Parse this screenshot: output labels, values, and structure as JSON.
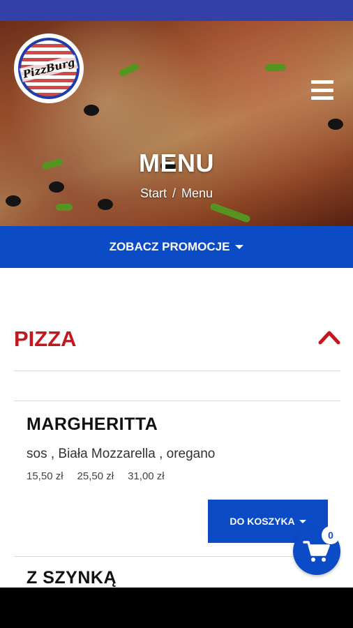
{
  "header": {
    "logo_text": "PizzBurg",
    "title": "MENU",
    "breadcrumb": {
      "start": "Start",
      "separator": "/",
      "current": "Menu"
    }
  },
  "promo": {
    "label": "ZOBACZ PROMOCJE"
  },
  "section": {
    "title": "PIZZA"
  },
  "items": [
    {
      "name": "MARGHERITTA",
      "description": "sos , Biała Mozzarella , oregano",
      "prices": [
        "15,50 zł",
        "25,50 zł",
        "31,00 zł"
      ],
      "add_label": "DO KOSZYKA"
    },
    {
      "name": "Z SZYNKĄ"
    }
  ],
  "cart": {
    "count": "0"
  },
  "colors": {
    "accent": "#0c4bc6",
    "status_bar": "#3240a8",
    "section_title": "#c4161c"
  },
  "icons": {
    "menu": "hamburger-icon",
    "collapse": "chevron-up-icon",
    "cart": "cart-icon"
  }
}
